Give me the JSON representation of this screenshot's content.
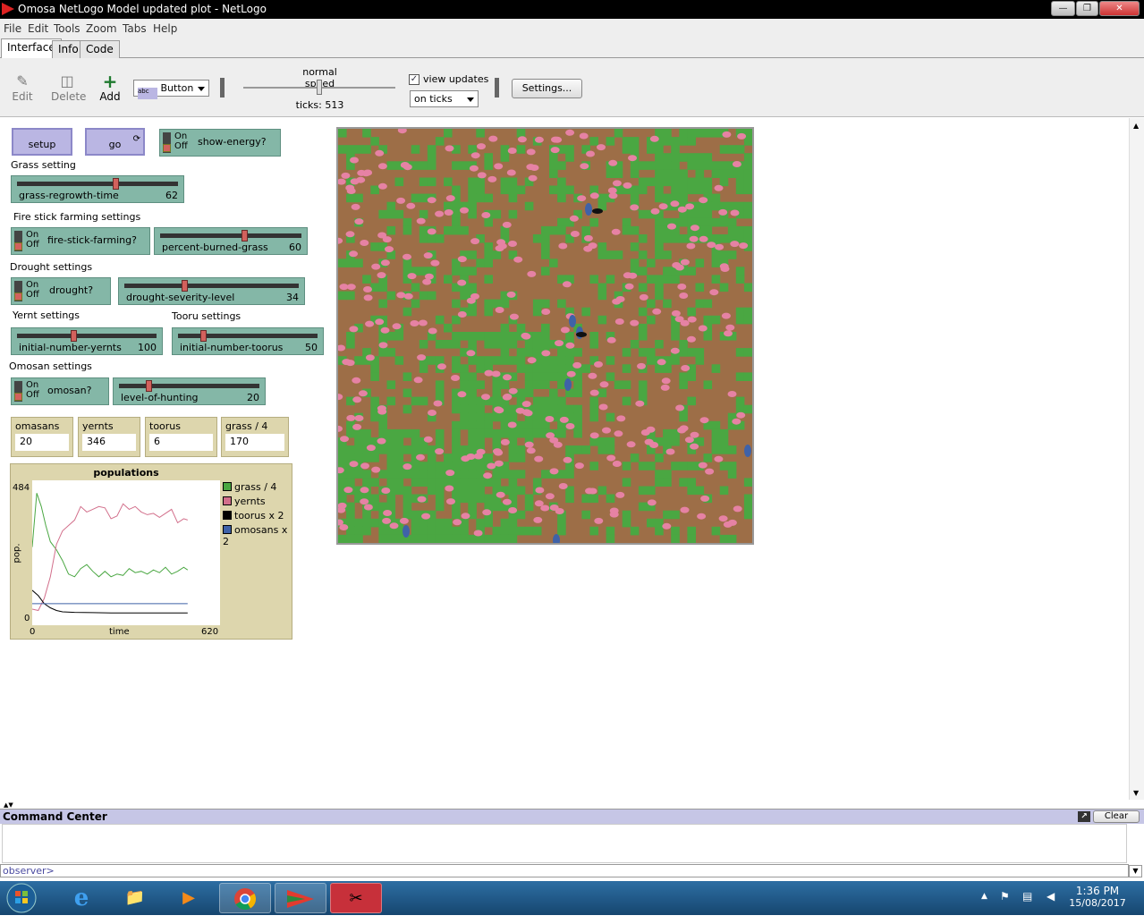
{
  "window": {
    "title": "Omosa NetLogo Model updated plot - NetLogo"
  },
  "menu": [
    "File",
    "Edit",
    "Tools",
    "Zoom",
    "Tabs",
    "Help"
  ],
  "tabs": [
    "Interface",
    "Info",
    "Code"
  ],
  "toolbar": {
    "edit": "Edit",
    "delete": "Delete",
    "add": "Add",
    "widget_type": "Button",
    "speed_label": "normal speed",
    "speed_value": 0.5,
    "ticks": "ticks: 513",
    "view_updates": "view updates",
    "update_mode": "on ticks",
    "settings": "Settings..."
  },
  "buttons": {
    "setup": "setup",
    "go": "go"
  },
  "switches": {
    "show_energy": {
      "label": "show-energy?",
      "state": "off"
    },
    "fire_stick": {
      "label": "fire-stick-farming?",
      "state": "off"
    },
    "drought": {
      "label": "drought?",
      "state": "off"
    },
    "omosan": {
      "label": "omosan?",
      "state": "off"
    },
    "on": "On",
    "off": "Off"
  },
  "notes": {
    "grass": "Grass setting",
    "fire": "Fire stick farming settings",
    "drought": "Drought settings",
    "yernt": "Yernt settings",
    "tooru": "Tooru settings",
    "omosan": "Omosan settings"
  },
  "sliders": {
    "grass_regrowth": {
      "label": "grass-regrowth-time",
      "value": "62",
      "fraction": 0.62
    },
    "percent_burned": {
      "label": "percent-burned-grass",
      "value": "60",
      "fraction": 0.6
    },
    "drought_severity": {
      "label": "drought-severity-level",
      "value": "34",
      "fraction": 0.34
    },
    "initial_yernts": {
      "label": "initial-number-yernts",
      "value": "100",
      "fraction": 0.4
    },
    "initial_toorus": {
      "label": "initial-number-toorus",
      "value": "50",
      "fraction": 0.17
    },
    "hunting": {
      "label": "level-of-hunting",
      "value": "20",
      "fraction": 0.2
    }
  },
  "monitors": [
    {
      "label": "omasans",
      "value": "20"
    },
    {
      "label": "yernts",
      "value": "346"
    },
    {
      "label": "toorus",
      "value": "6"
    },
    {
      "label": "grass / 4",
      "value": "170"
    }
  ],
  "plot": {
    "title": "populations",
    "ylabel": "pop.",
    "xlabel": "time",
    "ymax": "484",
    "ymin": "0",
    "xmin": "0",
    "xmax": "620",
    "legend": [
      "grass / 4",
      "yernts",
      "toorus x 2",
      "omosans x 2"
    ]
  },
  "chart_data": {
    "type": "line",
    "title": "populations",
    "xlabel": "time",
    "ylabel": "pop.",
    "xlim": [
      0,
      620
    ],
    "ylim": [
      0,
      484
    ],
    "series": [
      {
        "name": "grass / 4",
        "color": "#4aa742",
        "x": [
          0,
          15,
          30,
          45,
          60,
          80,
          100,
          120,
          140,
          160,
          180,
          200,
          220,
          240,
          260,
          280,
          300,
          320,
          340,
          360,
          380,
          400,
          420,
          440,
          460,
          480,
          500,
          513
        ],
        "values": [
          250,
          450,
          400,
          330,
          270,
          240,
          200,
          150,
          140,
          170,
          185,
          160,
          140,
          160,
          140,
          150,
          145,
          170,
          155,
          160,
          150,
          165,
          155,
          175,
          150,
          160,
          175,
          165
        ]
      },
      {
        "name": "yernts",
        "color": "#d26f8b",
        "x": [
          0,
          20,
          40,
          60,
          80,
          100,
          120,
          140,
          160,
          180,
          200,
          220,
          240,
          260,
          280,
          300,
          320,
          340,
          360,
          380,
          400,
          420,
          440,
          460,
          480,
          500,
          513
        ],
        "values": [
          20,
          15,
          60,
          140,
          260,
          310,
          330,
          350,
          400,
          380,
          390,
          400,
          395,
          355,
          365,
          410,
          390,
          400,
          380,
          370,
          375,
          360,
          375,
          390,
          340,
          355,
          350
        ]
      },
      {
        "name": "toorus x 2",
        "color": "#000000",
        "x": [
          0,
          20,
          40,
          60,
          80,
          100,
          140,
          200,
          260,
          320,
          380,
          440,
          513
        ],
        "values": [
          90,
          70,
          40,
          25,
          15,
          10,
          8,
          7,
          6,
          6,
          6,
          6,
          6
        ]
      },
      {
        "name": "omosans x 2",
        "color": "#3f62a8",
        "x": [
          0,
          100,
          200,
          300,
          400,
          513
        ],
        "values": [
          40,
          40,
          40,
          40,
          40,
          40
        ]
      }
    ]
  },
  "command_center": {
    "title": "Command Center",
    "clear": "Clear",
    "prompt": "observer>"
  },
  "taskbar": {
    "time": "1:36 PM",
    "date": "15/08/2017"
  }
}
